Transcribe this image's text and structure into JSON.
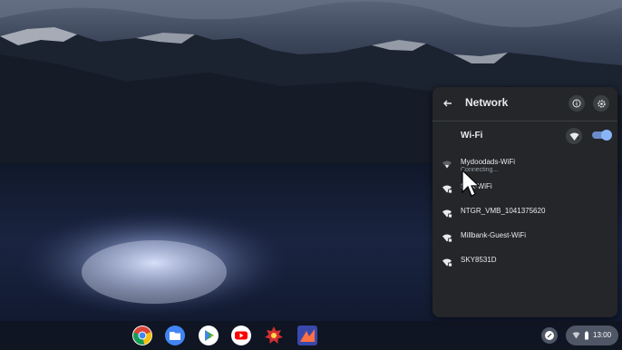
{
  "panel": {
    "title": "Network",
    "wifi_label": "Wi-Fi",
    "wifi_enabled": true,
    "networks": [
      {
        "name": "Mydoodads-WiFi",
        "status": "Connecting..."
      },
      {
        "name": "S      nk-WiFi",
        "status": ""
      },
      {
        "name": "NTGR_VMB_1041375620",
        "status": ""
      },
      {
        "name": "Millbank-Guest-WiFi",
        "status": ""
      },
      {
        "name": "SKY8531D",
        "status": ""
      }
    ]
  },
  "shelf": {
    "apps": [
      "chrome-icon",
      "files-icon",
      "play-store-icon",
      "youtube-icon",
      "photos-icon",
      "app-icon"
    ],
    "time": "13:00"
  },
  "colors": {
    "panel_bg": "#242629",
    "accent": "#8ab4f8"
  }
}
